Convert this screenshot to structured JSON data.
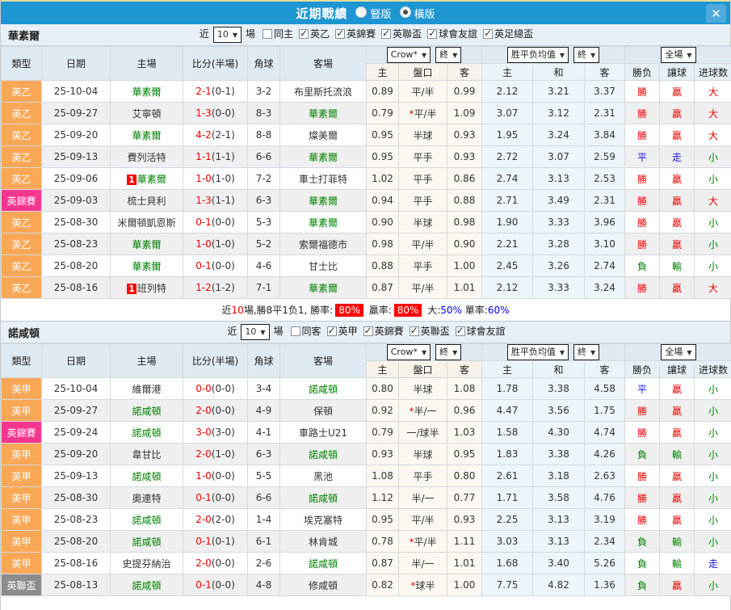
{
  "title_bar": {
    "title": "近期戰績",
    "radios": [
      {
        "label": "豎版",
        "checked": false
      },
      {
        "label": "橫版",
        "checked": true
      }
    ],
    "close_icon": "✕"
  },
  "colors": {
    "header_blue": "#1E96D2",
    "type_orange": "#FAA857",
    "type_pink": "#F5368F",
    "type_gray": "#8C8C8C",
    "win_red": "#E80000",
    "lose_green": "#008000",
    "draw_blue": "#1515E0",
    "team_green": "#008000",
    "odds_col_bg": "#FCF8F1",
    "mean_col_bg": "#EBF5FA"
  },
  "table_headers": {
    "type": "類型",
    "date": "日期",
    "home": "主場",
    "score": "比分(半場)",
    "corner": "角球",
    "away": "客場",
    "odds_company_select": "Crow*",
    "odds_final_select": "終",
    "mean_select": "胜平负均值",
    "mean_final_select": "終",
    "full_select": "全場",
    "odds_home": "主",
    "odds_handicap": "盤口",
    "odds_away": "客",
    "mean_home": "主",
    "mean_draw": "和",
    "mean_away": "客",
    "result": "勝负",
    "handicap_result": "讓球",
    "goals": "进球数"
  },
  "sections": [
    {
      "team": "華素爾",
      "filter": {
        "near_label": "近",
        "near_value": "10",
        "games_label": "場",
        "checkboxes": [
          {
            "label": "同主",
            "checked": false
          },
          {
            "label": "英乙",
            "checked": true
          },
          {
            "label": "英錦賽",
            "checked": true
          },
          {
            "label": "英聯盃",
            "checked": true
          },
          {
            "label": "球會友誼",
            "checked": true
          },
          {
            "label": "英足總盃",
            "checked": true
          }
        ]
      },
      "rows": [
        {
          "league": "英乙",
          "league_color": "orange",
          "date": "25-10-04",
          "home": "華素爾",
          "home_is_team": true,
          "home_badge": "",
          "score": "2-1",
          "half": "(0-1)",
          "corners": "3-2",
          "away": "布里斯托流浪",
          "away_is_team": false,
          "odds_home": "0.89",
          "handicap": "平/半",
          "odds_away": "0.99",
          "mean_home": "2.12",
          "mean_draw": "3.21",
          "mean_away": "3.37",
          "result": "勝",
          "result_color": "red",
          "handicap_result": "贏",
          "handicap_result_color": "red",
          "goals": "大",
          "goals_color": "red"
        },
        {
          "league": "英乙",
          "league_color": "orange",
          "date": "25-09-27",
          "home": "艾寧頓",
          "home_is_team": false,
          "home_badge": "",
          "score": "1-3",
          "half": "(0-0)",
          "corners": "8-3",
          "away": "華素爾",
          "away_is_team": true,
          "odds_home": "0.79",
          "handicap": "*平/半",
          "odds_away": "1.09",
          "mean_home": "3.07",
          "mean_draw": "3.12",
          "mean_away": "2.31",
          "result": "勝",
          "result_color": "red",
          "handicap_result": "贏",
          "handicap_result_color": "red",
          "goals": "大",
          "goals_color": "red"
        },
        {
          "league": "英乙",
          "league_color": "orange",
          "date": "25-09-20",
          "home": "華素爾",
          "home_is_team": true,
          "home_badge": "",
          "score": "4-2",
          "half": "(2-1)",
          "corners": "8-8",
          "away": "燦美爾",
          "away_is_team": false,
          "odds_home": "0.95",
          "handicap": "半球",
          "odds_away": "0.93",
          "mean_home": "1.95",
          "mean_draw": "3.24",
          "mean_away": "3.84",
          "result": "勝",
          "result_color": "red",
          "handicap_result": "贏",
          "handicap_result_color": "red",
          "goals": "大",
          "goals_color": "red"
        },
        {
          "league": "英乙",
          "league_color": "orange",
          "date": "25-09-13",
          "home": "費列活特",
          "home_is_team": false,
          "home_badge": "",
          "score": "1-1",
          "half": "(1-1)",
          "corners": "6-6",
          "away": "華素爾",
          "away_is_team": true,
          "odds_home": "0.95",
          "handicap": "平手",
          "odds_away": "0.93",
          "mean_home": "2.72",
          "mean_draw": "3.07",
          "mean_away": "2.59",
          "result": "平",
          "result_color": "blue",
          "handicap_result": "走",
          "handicap_result_color": "blue",
          "goals": "小",
          "goals_color": "green"
        },
        {
          "league": "英乙",
          "league_color": "orange",
          "date": "25-09-06",
          "home": "華素爾",
          "home_is_team": true,
          "home_badge": "1",
          "score": "1-0",
          "half": "(1-0)",
          "corners": "7-2",
          "away": "車士打菲特",
          "away_is_team": false,
          "odds_home": "1.02",
          "handicap": "平手",
          "odds_away": "0.86",
          "mean_home": "2.74",
          "mean_draw": "3.13",
          "mean_away": "2.53",
          "result": "勝",
          "result_color": "red",
          "handicap_result": "贏",
          "handicap_result_color": "red",
          "goals": "小",
          "goals_color": "green"
        },
        {
          "league": "英錦賽",
          "league_color": "pink",
          "date": "25-09-03",
          "home": "梳士貝利",
          "home_is_team": false,
          "home_badge": "",
          "score": "1-3",
          "half": "(1-1)",
          "corners": "6-3",
          "away": "華素爾",
          "away_is_team": true,
          "odds_home": "0.94",
          "handicap": "平手",
          "odds_away": "0.88",
          "mean_home": "2.71",
          "mean_draw": "3.49",
          "mean_away": "2.31",
          "result": "勝",
          "result_color": "red",
          "handicap_result": "贏",
          "handicap_result_color": "red",
          "goals": "大",
          "goals_color": "red"
        },
        {
          "league": "英乙",
          "league_color": "orange",
          "date": "25-08-30",
          "home": "米爾頓凱恩斯",
          "home_is_team": false,
          "home_badge": "",
          "score": "0-1",
          "half": "(0-0)",
          "corners": "5-3",
          "away": "華素爾",
          "away_is_team": true,
          "odds_home": "0.90",
          "handicap": "半球",
          "odds_away": "0.98",
          "mean_home": "1.90",
          "mean_draw": "3.33",
          "mean_away": "3.96",
          "result": "勝",
          "result_color": "red",
          "handicap_result": "贏",
          "handicap_result_color": "red",
          "goals": "小",
          "goals_color": "green"
        },
        {
          "league": "英乙",
          "league_color": "orange",
          "date": "25-08-23",
          "home": "華素爾",
          "home_is_team": true,
          "home_badge": "",
          "score": "1-0",
          "half": "(1-0)",
          "corners": "5-2",
          "away": "索爾福德市",
          "away_is_team": false,
          "odds_home": "0.98",
          "handicap": "平/半",
          "odds_away": "0.90",
          "mean_home": "2.21",
          "mean_draw": "3.28",
          "mean_away": "3.10",
          "result": "勝",
          "result_color": "red",
          "handicap_result": "贏",
          "handicap_result_color": "red",
          "goals": "小",
          "goals_color": "green"
        },
        {
          "league": "英乙",
          "league_color": "orange",
          "date": "25-08-20",
          "home": "華素爾",
          "home_is_team": true,
          "home_badge": "",
          "score": "0-1",
          "half": "(0-0)",
          "corners": "4-6",
          "away": "甘士比",
          "away_is_team": false,
          "odds_home": "0.88",
          "handicap": "平手",
          "odds_away": "1.00",
          "mean_home": "2.45",
          "mean_draw": "3.26",
          "mean_away": "2.74",
          "result": "負",
          "result_color": "green",
          "handicap_result": "輸",
          "handicap_result_color": "green",
          "goals": "小",
          "goals_color": "green"
        },
        {
          "league": "英乙",
          "league_color": "orange",
          "date": "25-08-16",
          "home": "班列特",
          "home_is_team": false,
          "home_badge": "1",
          "score": "1-2",
          "half": "(1-2)",
          "corners": "7-1",
          "away": "華素爾",
          "away_is_team": true,
          "odds_home": "0.87",
          "handicap": "平/半",
          "odds_away": "1.01",
          "mean_home": "2.12",
          "mean_draw": "3.33",
          "mean_away": "3.24",
          "result": "勝",
          "result_color": "red",
          "handicap_result": "贏",
          "handicap_result_color": "red",
          "goals": "大",
          "goals_color": "red"
        }
      ],
      "summary": [
        {
          "text": "近",
          "style": "plain"
        },
        {
          "text": "10",
          "style": "red-text"
        },
        {
          "text": "場,勝8平1负1, 勝率:",
          "style": "plain"
        },
        {
          "text": "80%",
          "style": "red-badge"
        },
        {
          "text": " 贏率:",
          "style": "plain"
        },
        {
          "text": "80%",
          "style": "red-badge"
        },
        {
          "text": " 大:",
          "style": "plain"
        },
        {
          "text": "50%",
          "style": "blue-text"
        },
        {
          "text": " 單率:",
          "style": "plain"
        },
        {
          "text": "60%",
          "style": "blue-text"
        }
      ]
    },
    {
      "team": "諾咸頓",
      "filter": {
        "near_label": "近",
        "near_value": "10",
        "games_label": "場",
        "checkboxes": [
          {
            "label": "同客",
            "checked": false
          },
          {
            "label": "英甲",
            "checked": true
          },
          {
            "label": "英錦賽",
            "checked": true
          },
          {
            "label": "英聯盃",
            "checked": true
          },
          {
            "label": "球會友誼",
            "checked": true
          }
        ]
      },
      "rows": [
        {
          "league": "英甲",
          "league_color": "orange",
          "date": "25-10-04",
          "home": "維爾港",
          "home_is_team": false,
          "home_badge": "",
          "score": "0-0",
          "half": "(0-0)",
          "corners": "3-4",
          "away": "諾咸頓",
          "away_is_team": true,
          "odds_home": "0.80",
          "handicap": "半球",
          "odds_away": "1.08",
          "mean_home": "1.78",
          "mean_draw": "3.38",
          "mean_away": "4.58",
          "result": "平",
          "result_color": "blue",
          "handicap_result": "贏",
          "handicap_result_color": "red",
          "goals": "小",
          "goals_color": "green"
        },
        {
          "league": "英甲",
          "league_color": "orange",
          "date": "25-09-27",
          "home": "諾咸頓",
          "home_is_team": true,
          "home_badge": "",
          "score": "2-0",
          "half": "(0-0)",
          "corners": "4-9",
          "away": "保頓",
          "away_is_team": false,
          "odds_home": "0.92",
          "handicap": "*半/一",
          "odds_away": "0.96",
          "mean_home": "4.47",
          "mean_draw": "3.56",
          "mean_away": "1.75",
          "result": "勝",
          "result_color": "red",
          "handicap_result": "贏",
          "handicap_result_color": "red",
          "goals": "小",
          "goals_color": "green"
        },
        {
          "league": "英錦賽",
          "league_color": "pink",
          "date": "25-09-24",
          "home": "諾咸頓",
          "home_is_team": true,
          "home_badge": "",
          "score": "3-0",
          "half": "(3-0)",
          "corners": "4-1",
          "away": "車路士U21",
          "away_is_team": false,
          "odds_home": "0.79",
          "handicap": "一/球半",
          "odds_away": "1.03",
          "mean_home": "1.58",
          "mean_draw": "4.30",
          "mean_away": "4.74",
          "result": "勝",
          "result_color": "red",
          "handicap_result": "贏",
          "handicap_result_color": "red",
          "goals": "小",
          "goals_color": "green"
        },
        {
          "league": "英甲",
          "league_color": "orange",
          "date": "25-09-20",
          "home": "韋甘比",
          "home_is_team": false,
          "home_badge": "",
          "score": "2-0",
          "half": "(1-0)",
          "corners": "6-3",
          "away": "諾咸頓",
          "away_is_team": true,
          "odds_home": "0.93",
          "handicap": "半球",
          "odds_away": "0.95",
          "mean_home": "1.83",
          "mean_draw": "3.38",
          "mean_away": "4.26",
          "result": "負",
          "result_color": "green",
          "handicap_result": "輸",
          "handicap_result_color": "green",
          "goals": "小",
          "goals_color": "green"
        },
        {
          "league": "英甲",
          "league_color": "orange",
          "date": "25-09-13",
          "home": "諾咸頓",
          "home_is_team": true,
          "home_badge": "",
          "score": "1-0",
          "half": "(0-0)",
          "corners": "5-5",
          "away": "黑池",
          "away_is_team": false,
          "odds_home": "1.08",
          "handicap": "平手",
          "odds_away": "0.80",
          "mean_home": "2.61",
          "mean_draw": "3.18",
          "mean_away": "2.63",
          "result": "勝",
          "result_color": "red",
          "handicap_result": "贏",
          "handicap_result_color": "red",
          "goals": "小",
          "goals_color": "green"
        },
        {
          "league": "英甲",
          "league_color": "orange",
          "date": "25-08-30",
          "home": "奧連特",
          "home_is_team": false,
          "home_badge": "",
          "score": "0-1",
          "half": "(0-0)",
          "corners": "6-6",
          "away": "諾咸頓",
          "away_is_team": true,
          "odds_home": "1.12",
          "handicap": "半/一",
          "odds_away": "0.77",
          "mean_home": "1.71",
          "mean_draw": "3.58",
          "mean_away": "4.76",
          "result": "勝",
          "result_color": "red",
          "handicap_result": "贏",
          "handicap_result_color": "red",
          "goals": "小",
          "goals_color": "green"
        },
        {
          "league": "英甲",
          "league_color": "orange",
          "date": "25-08-23",
          "home": "諾咸頓",
          "home_is_team": true,
          "home_badge": "",
          "score": "2-0",
          "half": "(2-0)",
          "corners": "1-4",
          "away": "埃克塞特",
          "away_is_team": false,
          "odds_home": "0.95",
          "handicap": "平/半",
          "odds_away": "0.93",
          "mean_home": "2.25",
          "mean_draw": "3.13",
          "mean_away": "3.19",
          "result": "勝",
          "result_color": "red",
          "handicap_result": "贏",
          "handicap_result_color": "red",
          "goals": "小",
          "goals_color": "green"
        },
        {
          "league": "英甲",
          "league_color": "orange",
          "date": "25-08-20",
          "home": "諾咸頓",
          "home_is_team": true,
          "home_badge": "",
          "score": "0-1",
          "half": "(0-1)",
          "corners": "6-1",
          "away": "林肯城",
          "away_is_team": false,
          "odds_home": "0.78",
          "handicap": "*平/半",
          "odds_away": "1.11",
          "mean_home": "3.03",
          "mean_draw": "3.13",
          "mean_away": "2.34",
          "result": "負",
          "result_color": "green",
          "handicap_result": "輸",
          "handicap_result_color": "green",
          "goals": "小",
          "goals_color": "green"
        },
        {
          "league": "英甲",
          "league_color": "orange",
          "date": "25-08-16",
          "home": "史提芬納治",
          "home_is_team": false,
          "home_badge": "",
          "score": "2-0",
          "half": "(0-0)",
          "corners": "2-6",
          "away": "諾咸頓",
          "away_is_team": true,
          "odds_home": "0.87",
          "handicap": "半/一",
          "odds_away": "1.01",
          "mean_home": "1.68",
          "mean_draw": "3.40",
          "mean_away": "5.26",
          "result": "負",
          "result_color": "green",
          "handicap_result": "輸",
          "handicap_result_color": "green",
          "goals": "走",
          "goals_color": "blue"
        },
        {
          "league": "英聯盃",
          "league_color": "gray",
          "date": "25-08-13",
          "home": "諾咸頓",
          "home_is_team": true,
          "home_badge": "",
          "score": "0-1",
          "half": "(0-0)",
          "corners": "4-8",
          "away": "修咸頓",
          "away_is_team": false,
          "odds_home": "0.82",
          "handicap": "*球半",
          "odds_away": "1.00",
          "mean_home": "7.75",
          "mean_draw": "4.82",
          "mean_away": "1.36",
          "result": "負",
          "result_color": "green",
          "handicap_result": "贏",
          "handicap_result_color": "red",
          "goals": "小",
          "goals_color": "green"
        }
      ],
      "summary": null
    }
  ]
}
